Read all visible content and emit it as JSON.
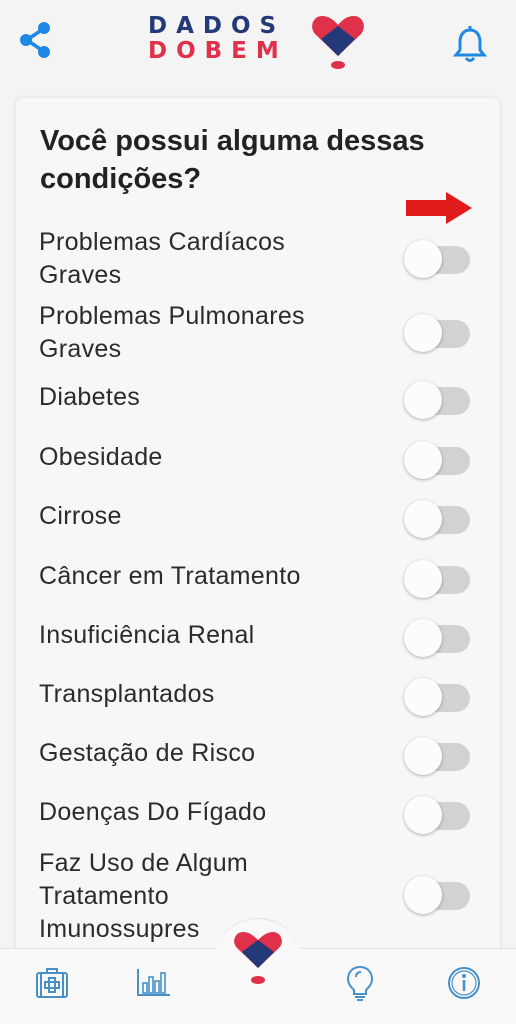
{
  "header": {
    "logo_line1": "DADOS",
    "logo_line2": "DOBEM",
    "share_icon": "share-icon",
    "bell_icon": "bell-icon"
  },
  "card": {
    "title": "Você possui alguma dessas condições?",
    "conditions": [
      {
        "label": "Problemas Cardíacos Graves",
        "enabled": false
      },
      {
        "label": "Problemas Pulmonares Graves",
        "enabled": false
      },
      {
        "label": "Diabetes",
        "enabled": false
      },
      {
        "label": "Obesidade",
        "enabled": false
      },
      {
        "label": "Cirrose",
        "enabled": false
      },
      {
        "label": "Câncer em Tratamento",
        "enabled": false
      },
      {
        "label": "Insuficiência Renal",
        "enabled": false
      },
      {
        "label": "Transplantados",
        "enabled": false
      },
      {
        "label": "Gestação de Risco",
        "enabled": false
      },
      {
        "label": "Doenças Do Fígado",
        "enabled": false
      },
      {
        "label": "Faz Uso de Algum Tratamento Imunossupres",
        "enabled": false
      }
    ]
  },
  "bottom_nav": {
    "items": [
      "medical-kit-icon",
      "bar-chart-icon",
      "heart-logo-icon",
      "lightbulb-icon",
      "info-icon"
    ]
  },
  "colors": {
    "brand_blue": "#1e88e5",
    "logo_navy": "#243a78",
    "logo_red": "#e0314a",
    "arrow_red": "#e01b1b",
    "toggle_track": "#d2d2d2"
  }
}
